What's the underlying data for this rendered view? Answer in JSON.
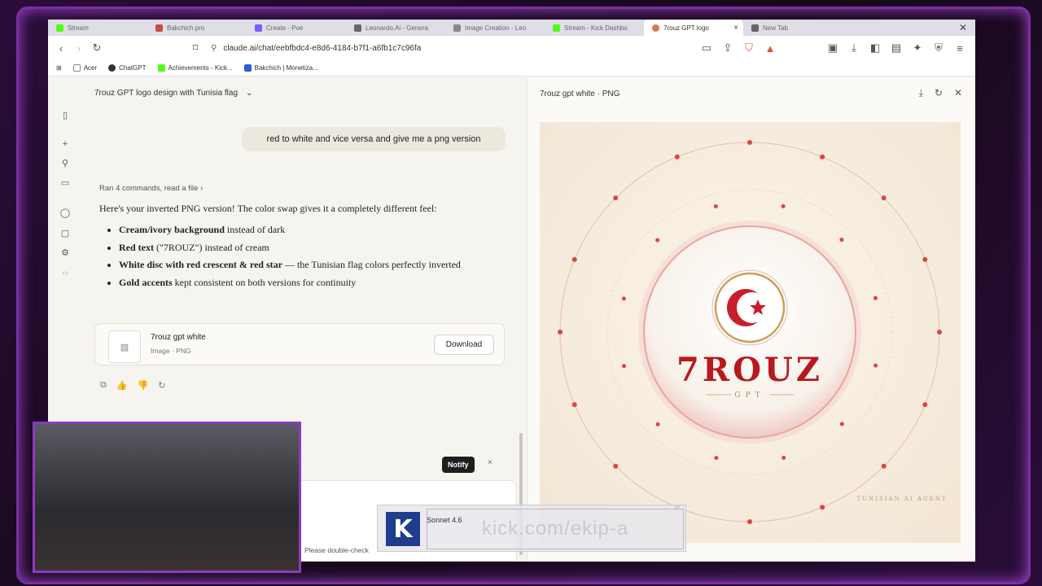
{
  "tabs": [
    {
      "label": "Stream",
      "color": "#53fc18"
    },
    {
      "label": "Bakchich pro",
      "color": "#c94c4c"
    },
    {
      "label": "Create - Poe",
      "color": "#7b5cff"
    },
    {
      "label": "Leonardo.Ai - Genera",
      "color": "#666666"
    },
    {
      "label": "Image Creation - Leo",
      "color": "#888888"
    },
    {
      "label": "Stream - Kick Dashbo",
      "color": "#53fc18"
    },
    {
      "label": "7rouz GPT logo",
      "color": "#d97757"
    },
    {
      "label": "New Tab",
      "color": "#666666"
    }
  ],
  "url": "claude.ai/chat/eebfbdc4-e8d6-4184-b7f1-a6fb1c7c96fa",
  "bookmarks": [
    {
      "label": "Acer",
      "color": "#888888"
    },
    {
      "label": "ChatGPT",
      "color": "#333333"
    },
    {
      "label": "Achievements - Kick...",
      "color": "#53fc18"
    },
    {
      "label": "Bakchich | Monetiza...",
      "color": "#2f5bd3"
    }
  ],
  "chat": {
    "title": "7rouz GPT logo design with Tunisia flag",
    "user_message": "red to white and vice versa  and give me a png version",
    "ran_commands": "Ran 4 commands, read a file",
    "reply_intro": "Here's your inverted PNG version! The color swap gives it a completely different feel:",
    "bullets": [
      {
        "bold": "Cream/ivory background",
        "rest": " instead of dark"
      },
      {
        "bold": "Red text",
        "rest": " (\"7ROUZ\") instead of cream"
      },
      {
        "bold": "White disc with red crescent & red star",
        "rest": " — the Tunisian flag colors perfectly inverted"
      },
      {
        "bold": "Gold accents",
        "rest": " kept consistent on both versions for continuity"
      }
    ],
    "file_name": "7rouz gpt white",
    "file_meta": "Image · PNG",
    "download_label": "Download",
    "notify_label": "Notify",
    "disclaimer": "Please double-check"
  },
  "artifact": {
    "title": "7rouz gpt white · PNG",
    "logo_text": "7ROUZ",
    "logo_sub": "GPT",
    "tagline": "TUNISIAN AI AGENT"
  },
  "overlay": {
    "kick_letter": "K",
    "model": "Sonnet 4.6",
    "kick_url": "kick.com/ekip-a"
  }
}
